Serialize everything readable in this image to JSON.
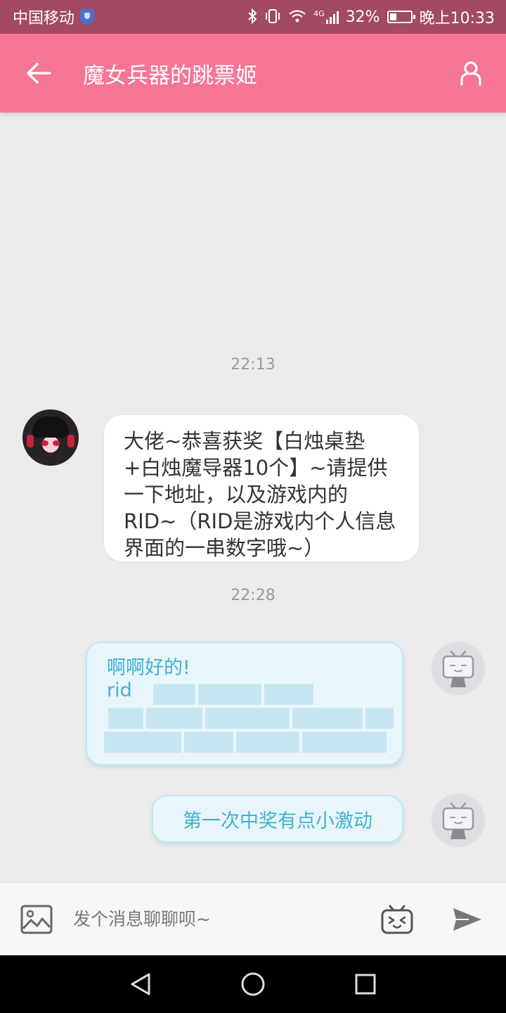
{
  "status_bar": {
    "carrier": "中国移动",
    "network": "4G",
    "battery": "32%",
    "battery_level": 0.32,
    "time": "晚上10:33"
  },
  "header": {
    "title": "魔女兵器的跳票姬"
  },
  "messages": [
    {
      "time": "22:13"
    },
    {
      "sender": "other",
      "text": "大佬~恭喜获奖【白烛桌垫+白烛魔导器10个】~请提供一下地址，以及游戏内的RID~（RID是游戏内个人信息界面的一串数字哦~）"
    },
    {
      "time": "22:28"
    },
    {
      "sender": "self",
      "line1": "啊啊好的!",
      "line2": "rid"
    },
    {
      "sender": "self",
      "text": "第一次中奖有点小激动"
    }
  ],
  "input": {
    "placeholder": "发个消息聊聊呗~"
  },
  "colors": {
    "status_bar": "#a14a62",
    "app_bar": "#f57595",
    "background": "#ebebeb",
    "outgoing_text": "#3fb2d3",
    "outgoing_bubble": "#e8f6fb"
  },
  "icons": {
    "back": "arrow-left-icon",
    "profile": "user-icon",
    "image": "image-icon",
    "emoji": "bilibili-tv-emoji-icon",
    "send": "send-icon"
  }
}
